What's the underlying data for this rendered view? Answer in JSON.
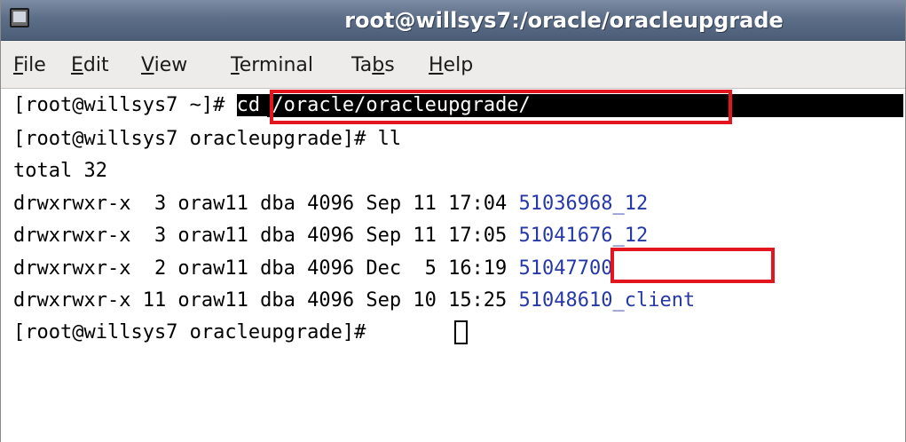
{
  "window": {
    "title": "root@willsys7:/oracle/oracleupgrade",
    "icon": "terminal-icon"
  },
  "menu": {
    "items": [
      {
        "label": "File",
        "mnemonic": "F"
      },
      {
        "label": "Edit",
        "mnemonic": "E"
      },
      {
        "label": "View",
        "mnemonic": "V"
      },
      {
        "label": "Terminal",
        "mnemonic": "T"
      },
      {
        "label": "Tabs",
        "mnemonic": "b"
      },
      {
        "label": "Help",
        "mnemonic": "H"
      }
    ]
  },
  "terminal": {
    "lines": {
      "prompt1": "[root@willsys7 ~]# ",
      "cmd1": "cd /oracle/oracleupgrade/",
      "prompt2": "[root@willsys7 oracleupgrade]# ll",
      "total": "total 32",
      "row1_info": "drwxrwxr-x  3 oraw11 dba 4096 Sep 11 17:04 ",
      "row1_name": "51036968_12",
      "row2_info": "drwxrwxr-x  3 oraw11 dba 4096 Sep 11 17:05 ",
      "row2_name": "51041676_12",
      "row3_info": "drwxrwxr-x  2 oraw11 dba 4096 Dec  5 16:19 ",
      "row3_name": "51047700",
      "row4_info": "drwxrwxr-x 11 oraw11 dba 4096 Sep 10 15:25 ",
      "row4_name": "51048610_client",
      "prompt3": "[root@willsys7 oracleupgrade]# "
    }
  },
  "colors": {
    "highlight_box": "#e3161f",
    "directory_link": "#2638a8",
    "selection": "#000000"
  }
}
